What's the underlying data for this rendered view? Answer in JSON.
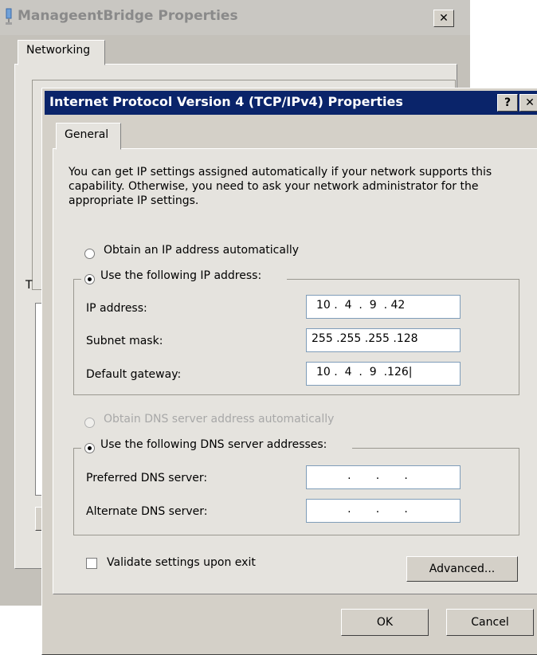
{
  "background_dialog": {
    "title": "ManageentBridge Properties",
    "close_glyph": "✕",
    "tab": "Networking",
    "partial_label": "T",
    "partial_button": ""
  },
  "dialog": {
    "title": "Internet Protocol Version 4 (TCP/IPv4) Properties",
    "help_glyph": "?",
    "close_glyph": "✕",
    "tab": "General",
    "intro": "You can get IP settings assigned automatically if your network supports this capability. Otherwise, you need to ask your network administrator for the appropriate IP settings.",
    "ip_mode": {
      "auto_label": "Obtain an IP address automatically",
      "manual_label": "Use the following IP address:",
      "selected": "manual"
    },
    "ip_fields": {
      "ip_address": {
        "label": "IP address:",
        "value": "10 .  4  .  9  . 42"
      },
      "subnet_mask": {
        "label": "Subnet mask:",
        "value": "255 .255 .255 .128"
      },
      "default_gateway": {
        "label": "Default gateway:",
        "value": "10 .  4  .  9  .126|"
      }
    },
    "dns_mode": {
      "auto_label": "Obtain DNS server address automatically",
      "manual_label": "Use the following DNS server addresses:",
      "selected": "manual",
      "auto_enabled": false
    },
    "dns_fields": {
      "preferred": {
        "label": "Preferred DNS server:",
        "value": "       .       .       ."
      },
      "alternate": {
        "label": "Alternate DNS server:",
        "value": "       .       .       ."
      }
    },
    "validate": {
      "label": "Validate settings upon exit",
      "checked": false
    },
    "buttons": {
      "advanced": "Advanced...",
      "ok": "OK",
      "cancel": "Cancel"
    }
  },
  "colors": {
    "titlebar_active": "#0a246a",
    "face": "#d4d0c8",
    "panel": "#e5e3de",
    "field_border": "#7f9db9"
  },
  "icons": [
    "network-bridge-icon",
    "help-icon",
    "close-icon"
  ]
}
